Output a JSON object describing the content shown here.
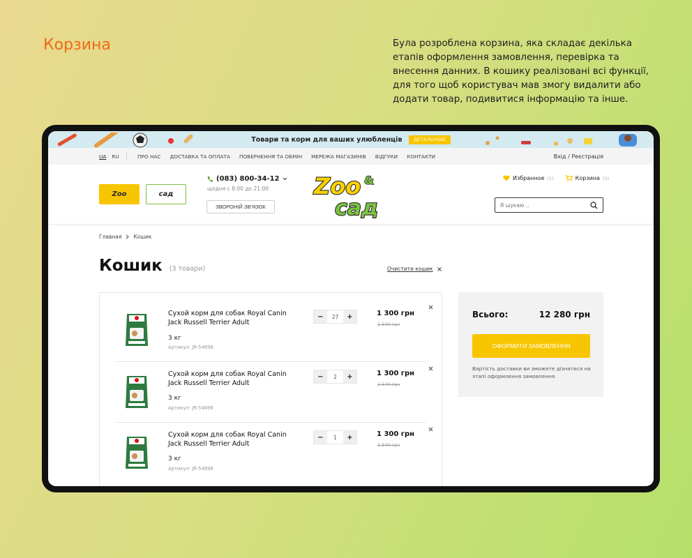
{
  "slide": {
    "title": "Корзина",
    "description": "Була розроблена корзина, яка складає декілька етапів оформлення замовлення, перевірка та внесення данних. В кошику реалізовані всі функції, для того щоб користувач мав змогу видалити або додати товар, подивитися інформацію та інше."
  },
  "promo": {
    "text": "Товари та корм для ваших улюбленців",
    "button": "ДЕТАЛЬНІШЕ"
  },
  "topnav": {
    "lang_active": "UA",
    "lang_other": "RU",
    "links": [
      "ПРО НАС",
      "ДОСТАВКА ТА ОПЛАТА",
      "ПОВЕРНЕННЯ ТА ОБМІН",
      "МЕРЕЖА МАГАЗИНІВ",
      "ВІДГУКИ",
      "КОНТАКТИ"
    ],
    "auth": "Вхід / Реєстрація"
  },
  "header": {
    "brand_zoo": "Zoo",
    "brand_sad": "сад",
    "phone": "(083) 800-34-12",
    "hours": "щодня с 8:00 до 21:00",
    "callback": "ЗВОРОНІЙ ЗВ'ЯЗОК",
    "favorites_label": "Избранное",
    "favorites_count": "(1)",
    "cart_label": "Корзина",
    "cart_count": "(5)",
    "search_placeholder": "Я шукаю ..",
    "logo_top": "Zoo",
    "logo_amp": "&",
    "logo_bottom": "сад"
  },
  "breadcrumb": {
    "home": "Главная",
    "current": "Кошик"
  },
  "cart": {
    "title": "Кошик",
    "count": "(3 товари)",
    "clear": "Очистити кошик",
    "items": [
      {
        "name": "Сухой корм для собак Royal Canin Jack Russell Terrier Adult",
        "weight": "3 кг",
        "sku": "Артикул: JR-54698",
        "qty": "27",
        "price": "1 300 грн",
        "old_price": "2 540 грн"
      },
      {
        "name": "Сухой корм для собак Royal Canin Jack Russell Terrier Adult",
        "weight": "3 кг",
        "sku": "Артикул: JR-54698",
        "qty": "2",
        "price": "1 300 грн",
        "old_price": "2 540 грн"
      },
      {
        "name": "Сухой корм для собак Royal Canin Jack Russell Terrier Adult",
        "weight": "3 кг",
        "sku": "Артикул: JR-54698",
        "qty": "1",
        "price": "1 300 грн",
        "old_price": "2 540 грн"
      }
    ]
  },
  "summary": {
    "label": "Всього:",
    "total": "12 280 грн",
    "checkout": "ОФОРМИТИ ЗАМОВЛЕННЯ",
    "delivery_note": "Вартість доставки ви зможете дізнатися на этапі оформлення замовлення"
  },
  "colors": {
    "accent_orange": "#f06a14",
    "brand_yellow": "#f8c600",
    "brand_green": "#7cc242"
  }
}
